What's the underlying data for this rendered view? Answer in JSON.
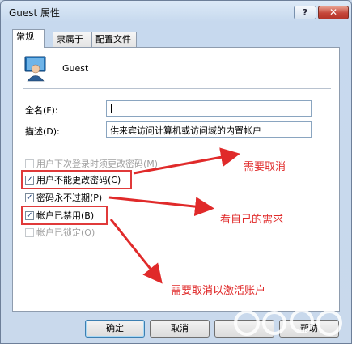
{
  "window": {
    "title": "Guest 属性",
    "help": "?",
    "close": "✕"
  },
  "tabs": [
    {
      "label": "常规"
    },
    {
      "label": "隶属于"
    },
    {
      "label": "配置文件"
    }
  ],
  "user": {
    "name": "Guest",
    "icon": "user-icon"
  },
  "fields": {
    "fullname_label": "全名(F):",
    "fullname_value": "",
    "desc_label": "描述(D):",
    "desc_value": "供来宾访问计算机或访问域的内置帐户"
  },
  "checkboxes": [
    {
      "label": "用户下次登录时须更改密码(M)",
      "checked": false,
      "enabled": false
    },
    {
      "label": "用户不能更改密码(C)",
      "checked": true,
      "enabled": true
    },
    {
      "label": "密码永不过期(P)",
      "checked": true,
      "enabled": true
    },
    {
      "label": "帐户已禁用(B)",
      "checked": true,
      "enabled": true
    },
    {
      "label": "帐户已锁定(O)",
      "checked": false,
      "enabled": false
    }
  ],
  "annotations": {
    "a1": "需要取消",
    "a2": "看自己的需求",
    "a3": "需要取消以激活账户",
    "color": "#e02a2a"
  },
  "buttons": {
    "ok": "确定",
    "cancel": "取消",
    "help": "帮助"
  },
  "watermark": {
    "icon": "watermark-logo"
  }
}
